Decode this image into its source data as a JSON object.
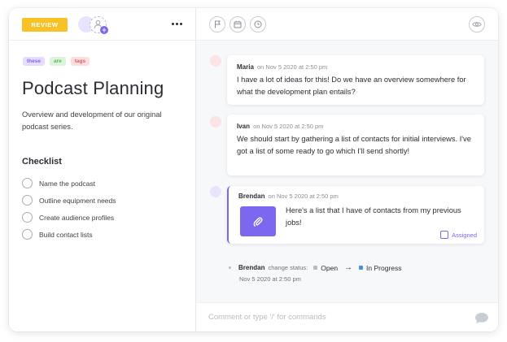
{
  "colors": {
    "accent": "#7b68ee",
    "review": "#f8c125",
    "status_open": "#b9bcc4",
    "status_in_progress": "#4a90e2"
  },
  "header": {
    "status_button": "REVIEW",
    "icons": [
      "user-plus-icon",
      "more-icon",
      "flag-icon",
      "calendar-icon",
      "clock-icon",
      "eye-icon"
    ]
  },
  "task": {
    "tags": [
      "these",
      "are",
      "tags"
    ],
    "title": "Podcast Planning",
    "description": "Overview and development of our original podcast series.",
    "checklist_title": "Checklist",
    "checklist": [
      {
        "label": "Name the podcast"
      },
      {
        "label": "Outline equipment needs"
      },
      {
        "label": "Create audience profiles"
      },
      {
        "label": "Build contact lists"
      }
    ]
  },
  "activity": {
    "messages": [
      {
        "author": "Maria",
        "meta": "on Nov 5 2020 at 2:50 pm",
        "text": "I have a lot of ideas for this! Do we have an overview somewhere for what the development plan entails?",
        "avatar_color": "#fbe3e6"
      },
      {
        "author": "Ivan",
        "meta": "on Nov 5 2020 at 2:50 pm",
        "text": "We should start by gathering a list of contacts for initial interviews. I've got a list of some ready to go which I'll send shortly!",
        "avatar_color": "#fbe3e6"
      },
      {
        "author": "Brendan",
        "meta": "on Nov 5 2020 at 2:50 pm",
        "text": "Here's a list that I have of contacts from my previous jobs!",
        "avatar_color": "#e9e4fd",
        "attachment_icon": "paperclip-icon",
        "assigned_label": "Assigned"
      }
    ],
    "status_change": {
      "author": "Brendan",
      "action": "change status:",
      "from": "Open",
      "arrow": "→",
      "to": "In Progress",
      "date": "Nov 5 2020 at 2:50 pm"
    }
  },
  "composer": {
    "placeholder": "Comment or type '/' for commands",
    "value": "",
    "send_icon": "chat-bubble-icon"
  }
}
